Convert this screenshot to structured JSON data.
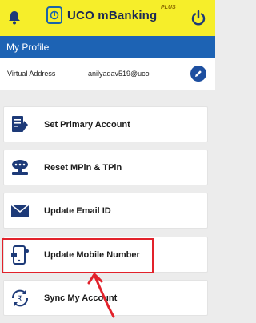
{
  "app": {
    "title": "UCO mBanking",
    "title_superscript": "PLUS",
    "brand_color": "#1d63b4",
    "header_color": "#f6ee2a"
  },
  "header": {
    "left_icon": "bell-icon",
    "right_icon": "power-icon"
  },
  "page": {
    "title": "My Profile"
  },
  "profile": {
    "virtual_address_label": "Virtual Address",
    "virtual_address_value": "anilyadav519@uco",
    "edit_icon": "pencil-icon"
  },
  "menu": {
    "items": [
      {
        "label": "Set Primary Account",
        "icon": "account-form-icon"
      },
      {
        "label": "Reset MPin & TPin",
        "icon": "pin-lock-icon"
      },
      {
        "label": "Update Email ID",
        "icon": "envelope-icon"
      },
      {
        "label": "Update Mobile Number",
        "icon": "mobile-phone-icon"
      },
      {
        "label": "Sync My Account",
        "icon": "sync-rupee-icon"
      }
    ]
  },
  "annotation": {
    "highlight_color": "#e2222b"
  }
}
